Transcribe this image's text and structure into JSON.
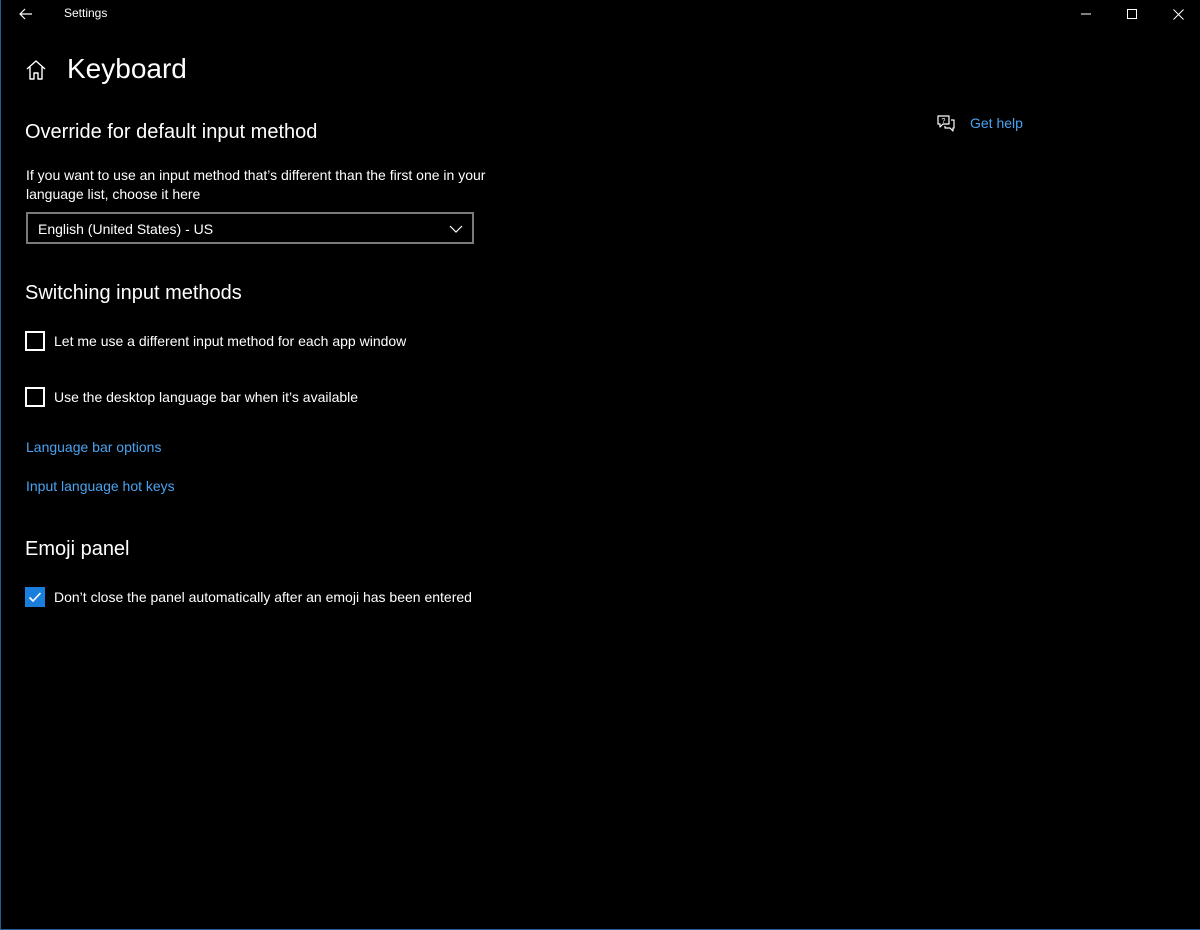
{
  "window": {
    "app_title": "Settings",
    "controls": {
      "back_icon": "back-arrow-icon",
      "minimize_icon": "minimize-icon",
      "maximize_icon": "maximize-icon",
      "close_icon": "close-icon"
    }
  },
  "header": {
    "home_icon": "home-icon",
    "title": "Keyboard"
  },
  "help": {
    "icon": "help-chat-icon",
    "label": "Get help"
  },
  "override_section": {
    "heading": "Override for default input method",
    "description": "If you want to use an input method that’s different than the first one in your language list, choose it here",
    "dropdown": {
      "selected": "English (United States) - US",
      "chevron_icon": "chevron-down-icon"
    }
  },
  "switching_section": {
    "heading": "Switching input methods",
    "options": [
      {
        "label": "Let me use a different input method for each app window",
        "checked": false
      },
      {
        "label": "Use the desktop language bar when it’s available",
        "checked": false
      }
    ],
    "links": {
      "language_bar_options": "Language bar options",
      "hot_keys": "Input language hot keys"
    }
  },
  "emoji_section": {
    "heading": "Emoji panel",
    "option": {
      "label": "Don’t close the panel automatically after an emoji has been entered",
      "checked": true
    }
  },
  "colors": {
    "background": "#000000",
    "text": "#ffffff",
    "link": "#4aa3f0",
    "accent": "#1a7fdc",
    "border": "#7a7a7a"
  }
}
